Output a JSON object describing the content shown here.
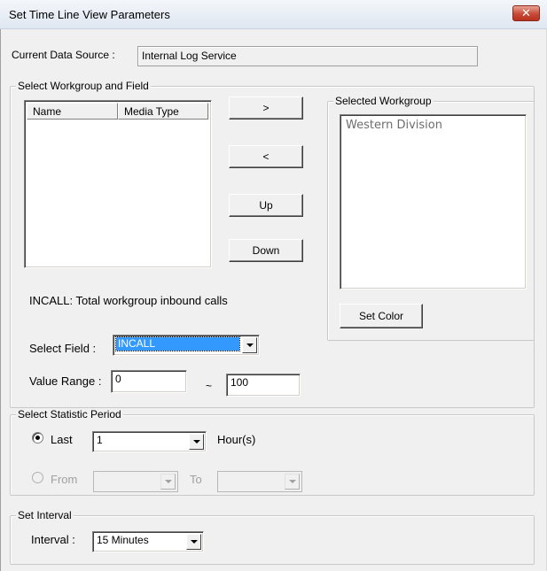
{
  "window": {
    "title": "Set Time Line View Parameters",
    "close_glyph": "✕"
  },
  "data_source": {
    "label": "Current Data Source :",
    "value": "Internal Log Service"
  },
  "workgroup_field_group": {
    "legend": "Select Workgroup and Field",
    "list_columns": [
      "Name",
      "Media Type"
    ],
    "buttons": {
      "add": ">",
      "remove": "<",
      "up": "Up",
      "down": "Down"
    },
    "field_description": "INCALL: Total workgroup inbound calls",
    "select_field_label": "Select Field :",
    "select_field_value": "INCALL",
    "value_range_label": "Value Range :",
    "value_range_min": "0",
    "value_range_separator": "~",
    "value_range_max": "100"
  },
  "selected_workgroup": {
    "legend": "Selected Workgroup",
    "items": [
      "Western Division"
    ],
    "set_color_label": "Set Color"
  },
  "statistic_period": {
    "legend": "Select Statistic Period",
    "last_label": "Last",
    "last_value": "1",
    "last_unit": "Hour(s)",
    "from_label": "From",
    "to_label": "To",
    "selected_option": "last"
  },
  "interval": {
    "legend": "Set Interval",
    "label": "Interval :",
    "value": "15 Minutes"
  }
}
